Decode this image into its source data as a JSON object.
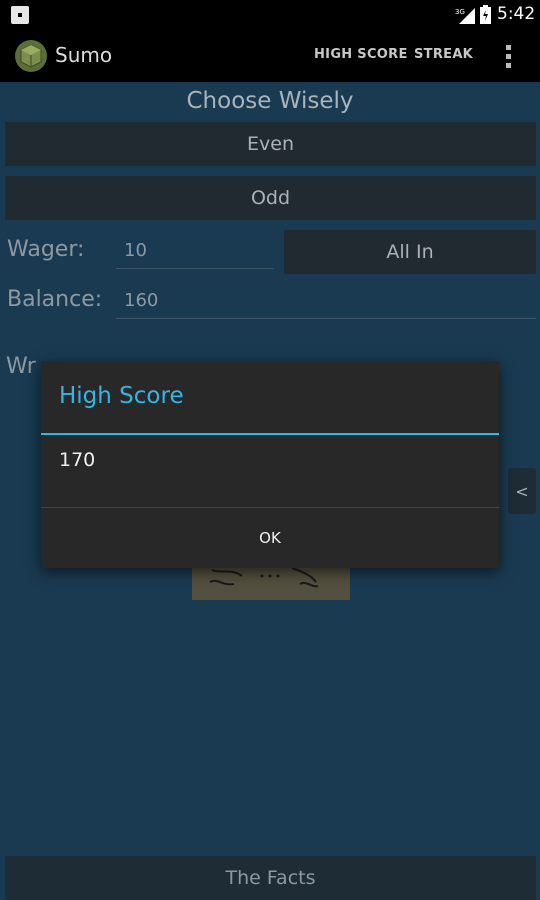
{
  "status_bar": {
    "time": "5:42",
    "network_badge": "3G",
    "icons": [
      "notification-icon",
      "signal-icon",
      "battery-icon"
    ]
  },
  "action_bar": {
    "app_title": "Sumo",
    "actions": [
      "HIGH SCORE",
      "STREAK"
    ],
    "overflow_icon": "overflow-menu-icon"
  },
  "main": {
    "heading": "Choose Wisely",
    "even_button": "Even",
    "odd_button": "Odd",
    "wager_label": "Wager:",
    "wager_value": "10",
    "all_in_button": "All In",
    "balance_label": "Balance:",
    "balance_value": "160",
    "partial_label": "Wr",
    "side_tab_icon": "<",
    "facts_button": "The Facts"
  },
  "dialog": {
    "title": "High Score",
    "message": "170",
    "ok_label": "OK"
  },
  "colors": {
    "background": "#1a3a52",
    "accent": "#33b5e5",
    "dialog_bg": "#282828"
  }
}
